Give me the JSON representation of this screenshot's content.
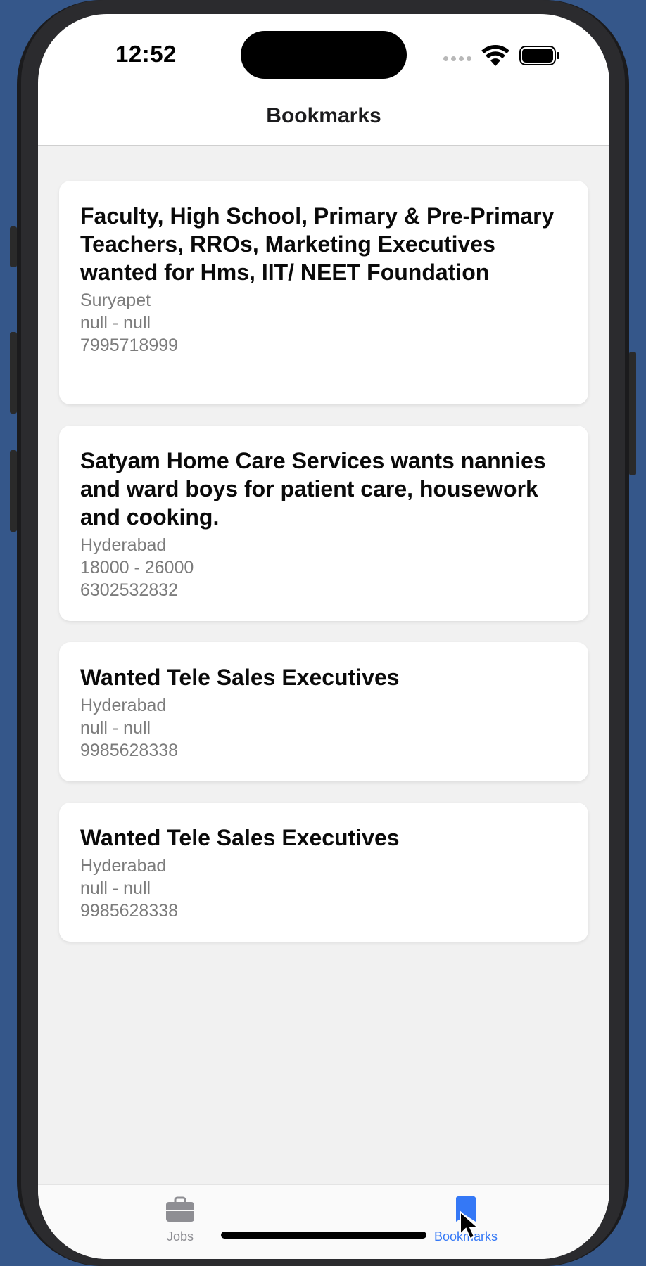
{
  "status_bar": {
    "time": "12:52",
    "icons": [
      "cellular-signal-icon",
      "wifi-icon",
      "battery-icon"
    ]
  },
  "nav": {
    "title": "Bookmarks"
  },
  "bookmarks": [
    {
      "title": "Faculty, High School, Primary & Pre-Primary Teachers, RROs, Marketing Executives wanted for Hms, IIT/ NEET Foundation",
      "location": "Suryapet",
      "salary": "null - null",
      "phone": "7995718999"
    },
    {
      "title": "Satyam Home Care Services wants nannies and ward boys for patient care, housework and cooking.",
      "location": "Hyderabad",
      "salary": "18000 - 26000",
      "phone": "6302532832"
    },
    {
      "title": "Wanted Tele Sales Executives",
      "location": "Hyderabad",
      "salary": "null - null",
      "phone": "9985628338"
    },
    {
      "title": "Wanted Tele Sales Executives",
      "location": "Hyderabad",
      "salary": "null - null",
      "phone": "9985628338"
    }
  ],
  "tab_bar": {
    "tabs": [
      {
        "label": "Jobs",
        "icon": "briefcase-icon",
        "active": false
      },
      {
        "label": "Bookmarks",
        "icon": "bookmark-icon",
        "active": true
      }
    ]
  },
  "colors": {
    "accent": "#3478f6",
    "inactive_tab": "#8e8e93",
    "background": "#f1f1f1",
    "card": "#ffffff",
    "desktop": "#35578a"
  }
}
